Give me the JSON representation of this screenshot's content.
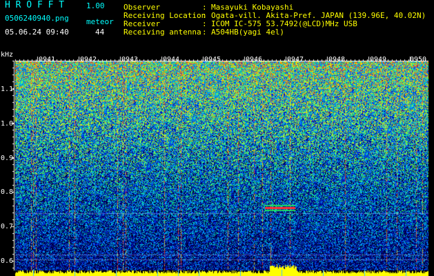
{
  "app": {
    "title": "H R O F F T",
    "version": "1.00",
    "filename": "0506240940.png",
    "datetime": "05.06.24 09:40",
    "meteor_label": "meteor",
    "meteor_count": "44"
  },
  "info": {
    "labels": [
      "Observer",
      "Receiving Location",
      "Receiver",
      "Receiving antenna"
    ],
    "colons": [
      ":",
      ":",
      ":",
      ":"
    ],
    "values": [
      "Masayuki Kobayashi",
      "Ogata-vill. Akita-Pref. JAPAN (139.96E, 40.02N)",
      "ICOM IC-575 53.7492(@LCD)MHz USB",
      "A504HB(yagi 4el)"
    ]
  },
  "chart_data": {
    "type": "heatmap",
    "ylabel": "kHz",
    "y_ticks": [
      "1.1",
      "1.0",
      "0.9",
      "0.8",
      "0.7",
      "0.6"
    ],
    "x_ticks": [
      "0941",
      "0942",
      "0943",
      "0944",
      "0945",
      "0946",
      "0947",
      "0948",
      "0949",
      "0950"
    ],
    "ylim": [
      0.58,
      1.17
    ]
  },
  "colors": {
    "title": "#00ffff",
    "info": "#ffff00",
    "axis": "#ffffff",
    "baseline": "#ffff00",
    "meteor_echo": "#ff3030"
  }
}
